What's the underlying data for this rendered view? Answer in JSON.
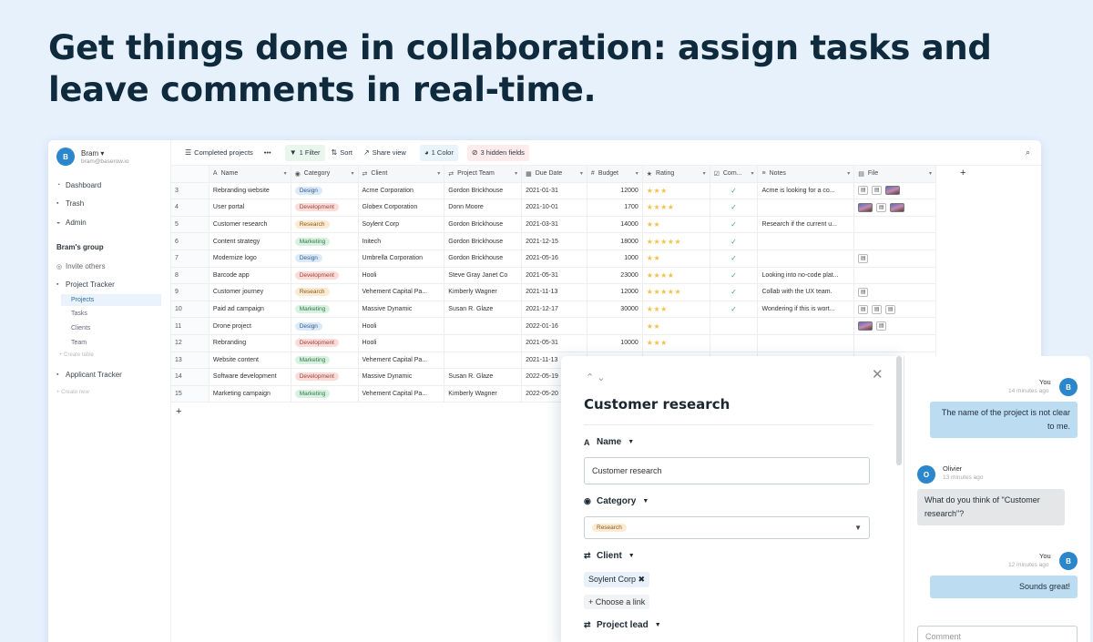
{
  "headline": "Get things done in collaboration: assign tasks and leave comments in real-time.",
  "sidebar": {
    "user_initial": "B",
    "user_name": "Bram ▾",
    "user_email": "bram@baserow.io",
    "nav": [
      {
        "icon": "dashboard-icon",
        "glyph": "◔",
        "label": "Dashboard"
      },
      {
        "icon": "trash-icon",
        "glyph": "▪",
        "label": "Trash"
      },
      {
        "icon": "admin-icon",
        "glyph": "◒",
        "label": "Admin"
      }
    ],
    "group_title": "Bram's group",
    "invite": "Invite others",
    "db1": "Project Tracker",
    "tables": [
      "Projects",
      "Tasks",
      "Clients",
      "Team"
    ],
    "create_table": "+ Create table",
    "db2": "Applicant Tracker",
    "create_db": "+ Create new"
  },
  "toolbar": {
    "view": "Completed projects",
    "more": "•••",
    "filter": "1 Filter",
    "sort": "Sort",
    "share": "Share view",
    "color": "1 Color",
    "hidden": "3 hidden fields"
  },
  "columns": [
    {
      "label": "Name",
      "glyph": "A"
    },
    {
      "label": "Category",
      "glyph": "◉"
    },
    {
      "label": "Client",
      "glyph": "⇄"
    },
    {
      "label": "Project Team",
      "glyph": "⇄"
    },
    {
      "label": "Due Date",
      "glyph": "▦"
    },
    {
      "label": "Budget",
      "glyph": "#"
    },
    {
      "label": "Rating",
      "glyph": "★"
    },
    {
      "label": "Com...",
      "glyph": "☑"
    },
    {
      "label": "Notes",
      "glyph": "≡"
    },
    {
      "label": "File",
      "glyph": "▤"
    }
  ],
  "rows": [
    {
      "id": "3",
      "name": "Rebranding website",
      "category": "Design",
      "client": "Acme Corporation",
      "team": "Gordon Brickhouse",
      "due": "2021-01-31",
      "budget": "12000",
      "rating": "★★★",
      "complete": "✓",
      "notes": "Acme is looking for a co...",
      "files": [
        "doc",
        "doc",
        "img"
      ]
    },
    {
      "id": "4",
      "name": "User portal",
      "category": "Development",
      "client": "Globex Corporation",
      "team": "Donn Moore",
      "due": "2021-10-01",
      "budget": "1700",
      "rating": "★★★★",
      "complete": "✓",
      "notes": "",
      "files": [
        "img",
        "doc",
        "img"
      ]
    },
    {
      "id": "5",
      "name": "Customer research",
      "category": "Research",
      "client": "Soylent Corp",
      "team": "Gordon Brickhouse",
      "due": "2021-03-31",
      "budget": "14000",
      "rating": "★★",
      "complete": "✓",
      "notes": "Research if the current u...",
      "files": []
    },
    {
      "id": "6",
      "name": "Content strategy",
      "category": "Marketing",
      "client": "Initech",
      "team": "Gordon Brickhouse",
      "due": "2021-12-15",
      "budget": "18000",
      "rating": "★★★★★",
      "complete": "✓",
      "notes": "",
      "files": []
    },
    {
      "id": "7",
      "name": "Modernize logo",
      "category": "Design",
      "client": "Umbrella Corporation",
      "team": "Gordon Brickhouse",
      "due": "2021-05-16",
      "budget": "1000",
      "rating": "★★",
      "complete": "✓",
      "notes": "",
      "files": [
        "doc"
      ]
    },
    {
      "id": "8",
      "name": "Barcode app",
      "category": "Development",
      "client": "Hooli",
      "team": "Steve Gray   Janet Co",
      "due": "2021-05-31",
      "budget": "23000",
      "rating": "★★★★",
      "complete": "✓",
      "notes": "Looking into no-code plat...",
      "files": []
    },
    {
      "id": "9",
      "name": "Customer journey",
      "category": "Research",
      "client": "Vehement Capital Pa...",
      "team": "Kimberly Wagner",
      "due": "2021-11-13",
      "budget": "12000",
      "rating": "★★★★★",
      "complete": "✓",
      "notes": "Collab with the UX team.",
      "files": [
        "doc"
      ]
    },
    {
      "id": "10",
      "name": "Paid ad campaign",
      "category": "Marketing",
      "client": "Massive Dynamic",
      "team": "Susan R. Glaze",
      "due": "2021-12-17",
      "budget": "30000",
      "rating": "★★★",
      "complete": "✓",
      "notes": "Wondering if this is wort...",
      "files": [
        "doc",
        "doc",
        "doc"
      ]
    },
    {
      "id": "11",
      "name": "Drone project",
      "category": "Design",
      "client": "Hooli",
      "team": "",
      "due": "2022-01-16",
      "budget": "",
      "rating": "★★",
      "complete": "",
      "notes": "",
      "files": [
        "img",
        "doc"
      ]
    },
    {
      "id": "12",
      "name": "Rebranding",
      "category": "Development",
      "client": "Hooli",
      "team": "",
      "due": "2021-05-31",
      "budget": "10000",
      "rating": "★★★",
      "complete": "",
      "notes": "",
      "files": []
    },
    {
      "id": "13",
      "name": "Website content",
      "category": "Marketing",
      "client": "Vehement Capital Pa...",
      "team": "",
      "due": "2021-11-13",
      "budget": "",
      "rating": "",
      "complete": "",
      "notes": "",
      "files": []
    },
    {
      "id": "14",
      "name": "Software development",
      "category": "Development",
      "client": "Massive Dynamic",
      "team": "Susan R. Glaze",
      "due": "2022-05-19",
      "budget": "",
      "rating": "",
      "complete": "",
      "notes": "",
      "files": []
    },
    {
      "id": "15",
      "name": "Marketing campaign",
      "category": "Marketing",
      "client": "Vehement Capital Pa...",
      "team": "Kimberly Wagner",
      "due": "2022-05-20",
      "budget": "",
      "rating": "",
      "complete": "",
      "notes": "",
      "files": []
    }
  ],
  "category_colors": {
    "Design": {
      "bg": "#dbe9f8",
      "fg": "#2f5f8f"
    },
    "Development": {
      "bg": "#fbdcd8",
      "fg": "#a4413a"
    },
    "Research": {
      "bg": "#fcebd2",
      "fg": "#8a5a1a"
    },
    "Marketing": {
      "bg": "#d9f1e0",
      "fg": "#2f7a4a"
    }
  },
  "add_row": "+",
  "add_col": "+",
  "detail": {
    "nav": "⌃ ⌄",
    "close": "✕",
    "title": "Customer research",
    "name_label": "Name",
    "name_value": "Customer research",
    "category_label": "Category",
    "category_value": "Research",
    "client_label": "Client",
    "client_value": "Soylent Corp ✖",
    "choose_link": "+ Choose a link",
    "lead_label": "Project lead"
  },
  "chat": {
    "messages": [
      {
        "author": "You",
        "time": "14 minutes ago",
        "initial": "B",
        "text": "The name of the project is not clear to me.",
        "mine": true
      },
      {
        "author": "Olivier",
        "time": "13 minutes ago",
        "initial": "O",
        "text": "What do you think of \"Customer research\"?",
        "mine": false
      },
      {
        "author": "You",
        "time": "12 minutes ago",
        "initial": "B",
        "text": "Sounds great!",
        "mine": true
      }
    ],
    "input_placeholder": "Comment"
  }
}
